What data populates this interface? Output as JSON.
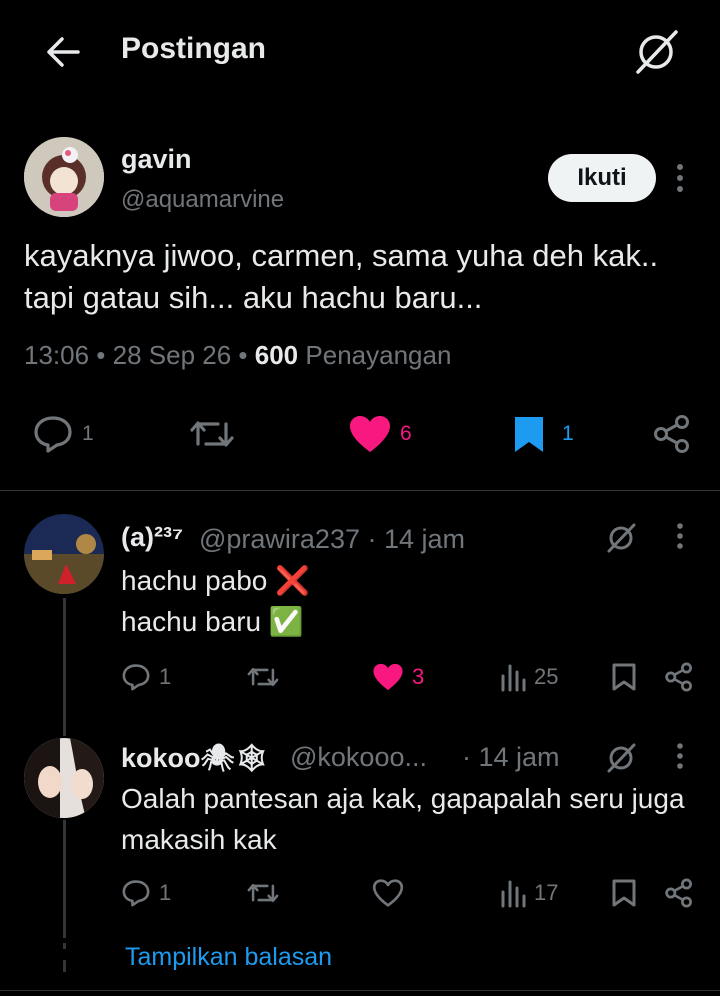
{
  "header": {
    "title": "Postingan"
  },
  "post": {
    "name": "gavin",
    "handle": "@aquamarvine",
    "follow_label": "Ikuti",
    "text": "kayaknya jiwoo, carmen, sama yuha deh kak.. tapi gatau sih... aku hachu baru...",
    "time": "13:06",
    "date": "28 Sep 26",
    "views": "600",
    "views_label": "Penayangan",
    "replies": "1",
    "likes": "6",
    "bookmarks": "1",
    "colors": {
      "like": "#f91880",
      "bookmark": "#1d9bf0"
    }
  },
  "replies": [
    {
      "name": "(a)²³⁷",
      "handle": "@prawira237 · 14 jam",
      "line1": "hachu pabo ❌",
      "line2": "hachu baru ✅",
      "replies": "1",
      "likes": "3",
      "views": "25"
    },
    {
      "name": "kokoo🕷🕸",
      "handle": "@kokooo...",
      "time": "· 14 jam",
      "text": "Oalah pantesan aja kak, gapapalah seru juga makasih kak",
      "replies": "1",
      "views": "17"
    }
  ],
  "show_replies": "Tampilkan balasan"
}
